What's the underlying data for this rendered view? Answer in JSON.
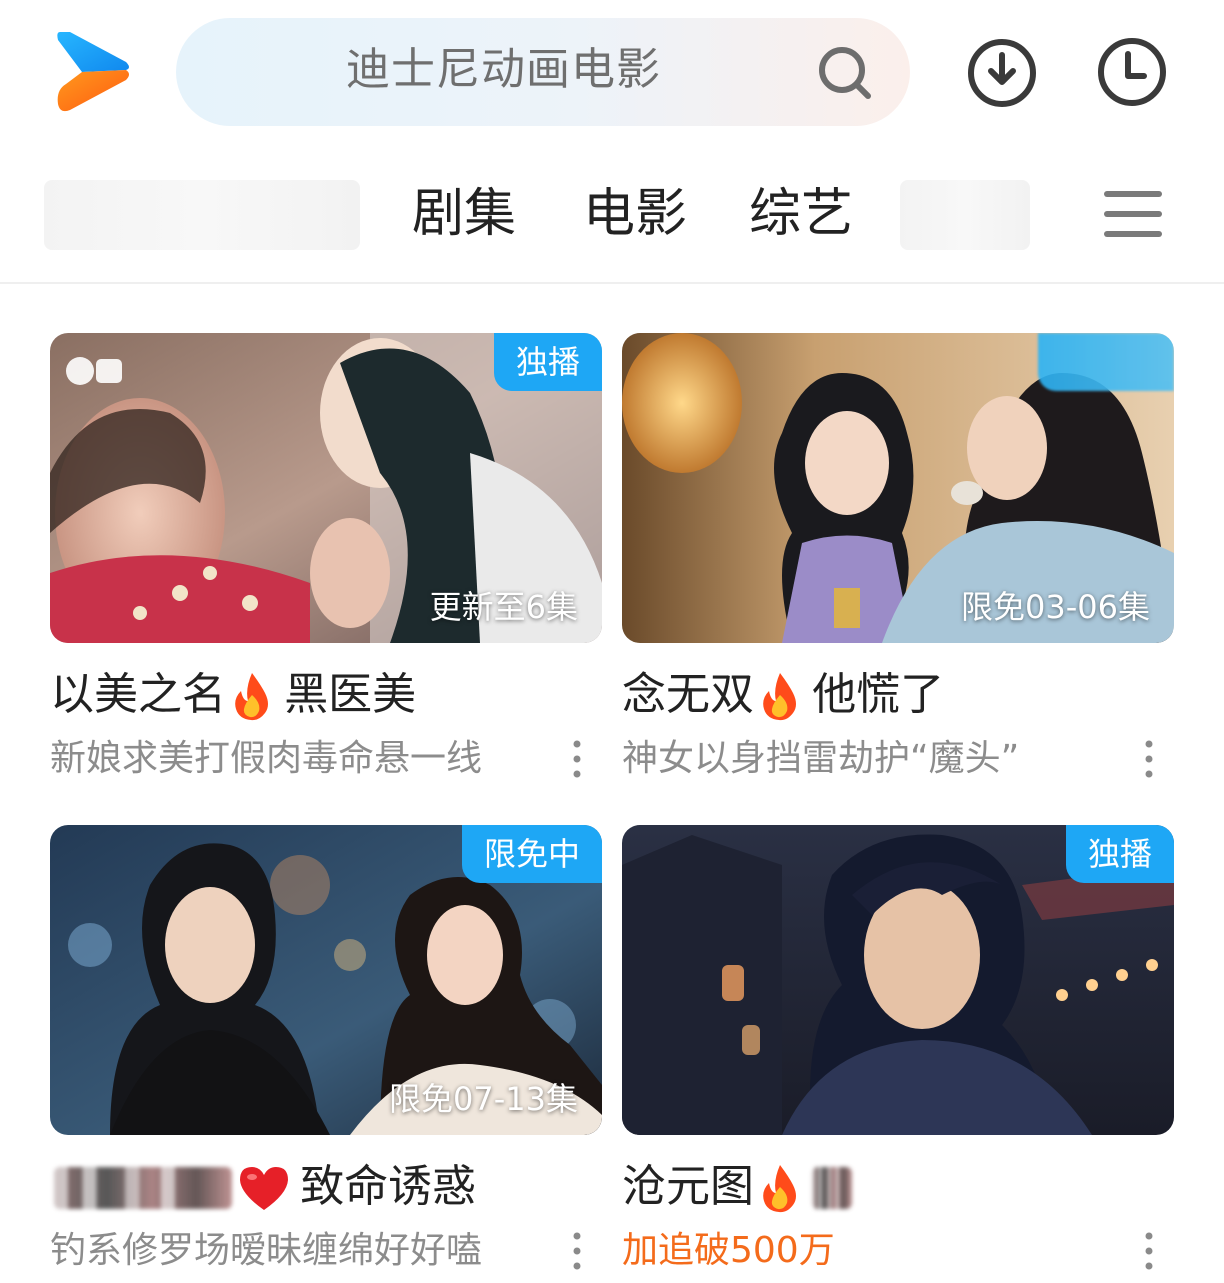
{
  "header": {
    "search_placeholder": "迪士尼动画电影",
    "icons": [
      "app-logo",
      "search-icon",
      "download-icon",
      "history-icon"
    ]
  },
  "tabs": [
    {
      "label": "剧集"
    },
    {
      "label": "电影"
    },
    {
      "label": "综艺"
    }
  ],
  "colors": {
    "badge": "#1ea7f5",
    "hot_text": "#f46b1b",
    "subtitle": "#8c8c8c",
    "logo_blue": "#1aa7f4",
    "logo_orange": "#ff7a17"
  },
  "cards": [
    {
      "badge": "独播",
      "episode": "更新至6集",
      "title": "以美之名",
      "title_suffix": "黑医美",
      "subtitle": "新娘求美打假肉毒命悬一线",
      "icon": "fire-icon"
    },
    {
      "badge": "",
      "episode": "限免03-06集",
      "title": "念无双",
      "title_suffix": "他慌了",
      "subtitle": "神女以身挡雷劫护“魔头”",
      "icon": "fire-icon"
    },
    {
      "badge": "限免中",
      "episode": "限免07-13集",
      "title": "",
      "title_suffix": "致命诱惑",
      "subtitle": "钓系修罗场暧昧缠绵好好嗑",
      "icon": "heart-icon"
    },
    {
      "badge": "独播",
      "episode": "",
      "title": "沧元图",
      "title_suffix": "",
      "subtitle": "加追破500万",
      "icon": "fire-icon"
    }
  ]
}
